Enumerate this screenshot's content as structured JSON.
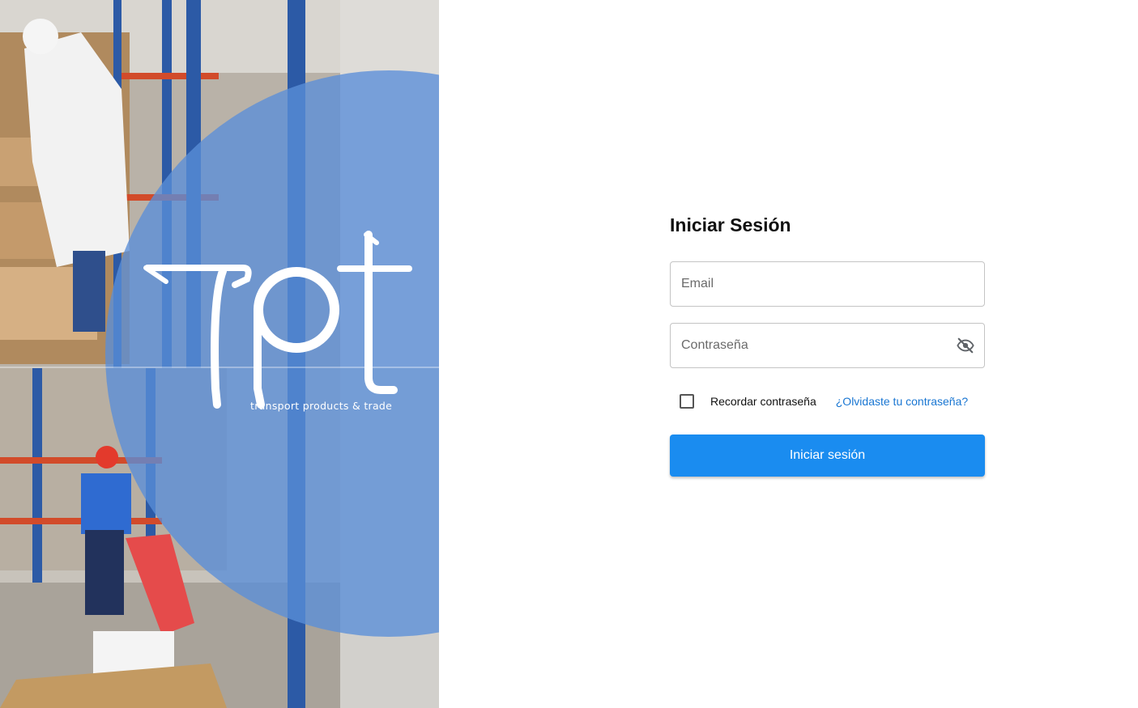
{
  "brand": {
    "tagline": "transport products & trade",
    "circle_color": "#5a8ed8"
  },
  "login": {
    "title": "Iniciar Sesión",
    "email_placeholder": "Email",
    "password_placeholder": "Contraseña",
    "remember_label": "Recordar contraseña",
    "remember_checked": false,
    "forgot_link": "¿Olvidaste tu contraseña?",
    "submit_label": "Iniciar sesión",
    "accent_color": "#1a8cf0",
    "link_color": "#1976d2"
  },
  "icons": {
    "password_toggle": "eye-off-icon"
  }
}
